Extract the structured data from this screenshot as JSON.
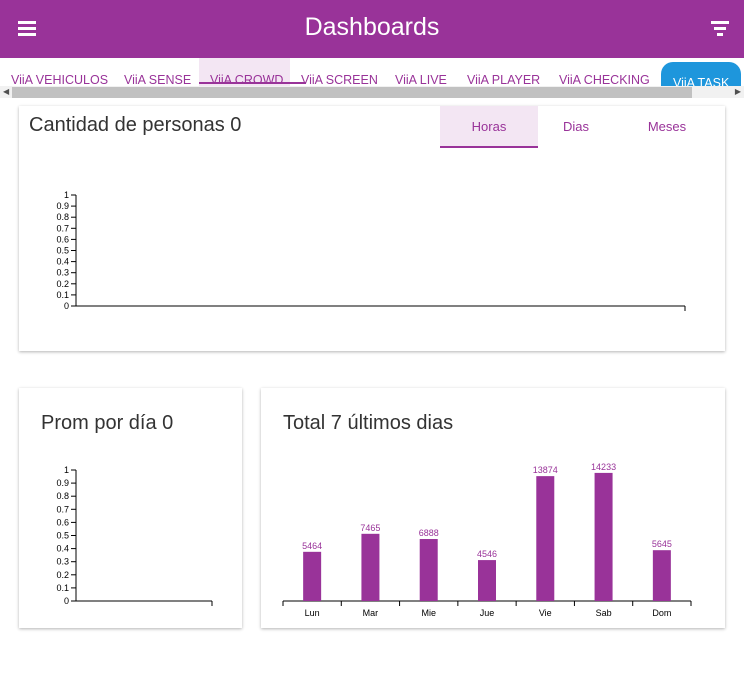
{
  "header": {
    "title": "Dashboards",
    "menu_icon": "hamburger-menu-icon",
    "filter_icon": "filter-icon",
    "color": "#993399"
  },
  "tabs": [
    {
      "label": "ViiA VEHICULOS"
    },
    {
      "label": "ViiA SENSE"
    },
    {
      "label": "ViiA CROWD",
      "active": true
    },
    {
      "label": "ViiA SCREEN"
    },
    {
      "label": "ViiA LIVE"
    },
    {
      "label": "ViiA PLAYER"
    },
    {
      "label": "ViiA CHECKING"
    },
    {
      "label": "ViiA TASK",
      "highlight": "#1e96dc"
    }
  ],
  "people_card": {
    "title": "Cantidad de personas 0",
    "segments": [
      {
        "label": "Horas",
        "active": true
      },
      {
        "label": "Dias"
      },
      {
        "label": "Meses"
      }
    ]
  },
  "avg_card": {
    "title": "Prom por día 0"
  },
  "total_card": {
    "title": "Total 7 últimos dias"
  },
  "chart_data": [
    {
      "type": "line",
      "series": [],
      "yticks": [
        "0",
        "0.1",
        "0.2",
        "0.3",
        "0.4",
        "0.5",
        "0.6",
        "0.7",
        "0.8",
        "0.9",
        "1"
      ],
      "ylim": [
        0,
        1
      ]
    },
    {
      "type": "line",
      "series": [],
      "yticks": [
        "0",
        "0.1",
        "0.2",
        "0.3",
        "0.4",
        "0.5",
        "0.6",
        "0.7",
        "0.8",
        "0.9",
        "1"
      ],
      "ylim": [
        0,
        1
      ]
    },
    {
      "type": "bar",
      "categories": [
        "Lun",
        "Mar",
        "Mie",
        "Jue",
        "Vie",
        "Sab",
        "Dom"
      ],
      "values": [
        5464,
        7465,
        6888,
        4546,
        13874,
        14233,
        5645
      ],
      "ylim": [
        0,
        17000
      ],
      "color": "#993399"
    }
  ]
}
